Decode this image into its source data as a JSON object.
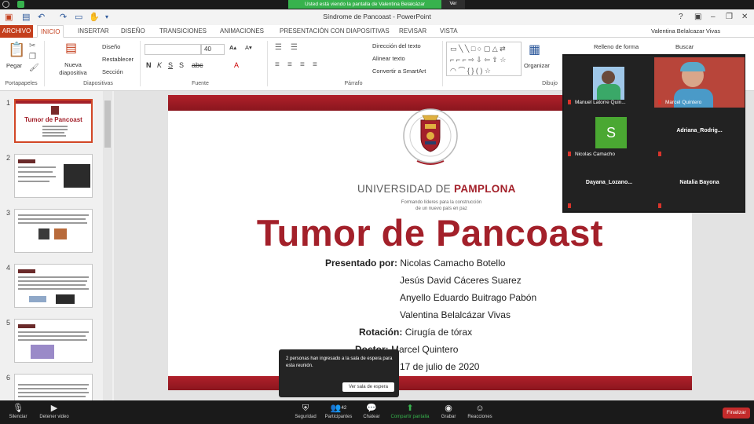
{
  "zoom_banner": {
    "sharing_text": "Usted está viendo la pantalla de Valentina Belalcázar",
    "options_label": "Ver Opciones"
  },
  "window": {
    "title": "Síndrome de Pancoast - PowerPoint"
  },
  "ribbon_tabs": [
    "ARCHIVO",
    "INICIO",
    "INSERTAR",
    "DISEÑO",
    "TRANSICIONES",
    "ANIMACIONES",
    "PRESENTACIÓN CON DIAPOSITIVAS",
    "REVISAR",
    "VISTA"
  ],
  "user_name": "Valentina Belalcazar Vivas",
  "ribbon": {
    "paste": "Pegar",
    "new_slide": "Nueva diapositiva",
    "layout": "Diseño",
    "reset": "Restablecer",
    "section": "Sección",
    "font_size": "40",
    "text_direction": "Dirección del texto",
    "align_text": "Alinear texto",
    "smartart": "Convertir a SmartArt",
    "arrange": "Organizar",
    "shape_fill": "Relleno de forma",
    "find": "Buscar",
    "groups": {
      "clipboard": "Portapapeles",
      "slides": "Diapositivas",
      "font": "Fuente",
      "paragraph": "Párrafo",
      "drawing": "Dibujo"
    }
  },
  "thumbnails": [
    {
      "num": "1",
      "title": "Tumor de Pancoast"
    },
    {
      "num": "2"
    },
    {
      "num": "3"
    },
    {
      "num": "4"
    },
    {
      "num": "5"
    },
    {
      "num": "6"
    }
  ],
  "slide": {
    "university_a": "UNIVERSIDAD DE ",
    "university_b": "PAMPLONA",
    "tagline_1": "Formando líderes para la construcción",
    "tagline_2": "de un nuevo país en paz",
    "title": "Tumor de Pancoast",
    "presented_label": "Presentado por:",
    "authors": [
      "Nicolas Camacho Botello",
      "Jesús David Cáceres Suarez",
      "Anyello Eduardo Buitrago Pabón",
      "Valentina Belalcázar Vivas"
    ],
    "rotation_label": "Rotación:",
    "rotation": "Cirugía de tórax",
    "doctor_label": "Doctor:",
    "doctor": "Marcel Quintero",
    "date": "17 de julio de 2020"
  },
  "participants": [
    {
      "name": "Manuel Latorre Quin...",
      "has_video": true
    },
    {
      "name": "Marcel Quintero",
      "has_video": true
    },
    {
      "name": "Nicolas Camacho",
      "initial": "S"
    },
    {
      "name": "Adriana_Rodrig..."
    },
    {
      "name": "Dayana_Lozano..."
    },
    {
      "name": "Natalia Bayona"
    }
  ],
  "toast": {
    "message": "2 personas han ingresado a la sala de espera para esta reunión.",
    "button": "Ver sala de espera"
  },
  "zoom_toolbar": {
    "mute": "Silenciar",
    "stop_video": "Detener video",
    "security": "Seguridad",
    "participants": "Participantes",
    "participants_count": "42",
    "chat": "Chatear",
    "share": "Compartir pantalla",
    "record": "Grabar",
    "reactions": "Reacciones",
    "end": "Finalizar"
  },
  "colors": {
    "accent_red": "#a3202a",
    "file_tab": "#c43e1c",
    "zoom_green": "#37b24d",
    "end_red": "#c42b2b"
  }
}
